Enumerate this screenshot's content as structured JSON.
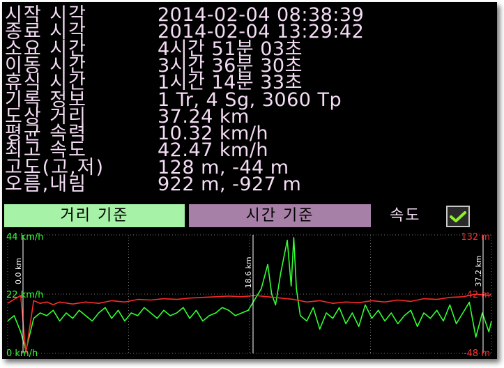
{
  "stats": [
    {
      "label": "시작 시각",
      "value": "2014-02-04 08:38:39"
    },
    {
      "label": "종료 시각",
      "value": "2014-02-04 13:29:42"
    },
    {
      "label": "소요 시간",
      "value": "4시간 51분 03초"
    },
    {
      "label": "이동 시간",
      "value": "3시간 36분 30초"
    },
    {
      "label": "휴식 시간",
      "value": "1시간 14분 33초"
    },
    {
      "label": "기록 정보",
      "value": "1 Tr, 4 Sg, 3060 Tp"
    },
    {
      "label": "도상 거리",
      "value": "37.24 km"
    },
    {
      "label": "평균 속력",
      "value": "10.32 km/h"
    },
    {
      "label": "최고 속도",
      "value": "42.47 km/h"
    },
    {
      "label": "고도(고,저)",
      "value": "128 m, -44 m"
    },
    {
      "label": "오름,내림",
      "value": "922 m, -927 m"
    }
  ],
  "buttons": {
    "distance": "거리 기준",
    "time": "시간 기준",
    "speed_label": "속도",
    "speed_checked": true
  },
  "colors": {
    "speed": "#33ff33",
    "altitude": "#ff2a2a",
    "axis_left_text": "#33ff33",
    "axis_right_text": "#ff3030",
    "grid": "#777777",
    "marker": "#ffffff"
  },
  "chart_data": {
    "type": "line",
    "x_unit": "km",
    "x_range": [
      0,
      37.2
    ],
    "markers": [
      "0.0 km",
      "18.6 km",
      "37.2 km"
    ],
    "left_axis": {
      "labels": [
        "44 km/h",
        "22 km/h",
        "0 km/h"
      ],
      "range": [
        0,
        44
      ]
    },
    "right_axis": {
      "labels": [
        "132 m",
        "42 m",
        "-48 m"
      ],
      "range": [
        -48,
        132
      ]
    },
    "series": [
      {
        "metric": "speed",
        "axis": "left",
        "x": [
          0,
          0.5,
          1.0,
          1.4,
          2.0,
          2.5,
          3.0,
          3.5,
          4.0,
          4.5,
          5.0,
          5.5,
          6.0,
          6.5,
          7.0,
          7.5,
          8.0,
          8.5,
          9.0,
          9.5,
          10.0,
          10.5,
          11.0,
          11.5,
          12.0,
          12.5,
          13.0,
          13.5,
          14.0,
          14.5,
          15.0,
          15.5,
          16.0,
          16.5,
          17.0,
          17.5,
          18.0,
          18.5,
          19.0,
          19.5,
          20.0,
          20.3,
          20.6,
          21.0,
          21.5,
          21.8,
          22.0,
          22.2,
          22.5,
          23.0,
          23.5,
          24.0,
          24.5,
          25.0,
          25.5,
          26.0,
          26.5,
          27.0,
          27.5,
          28.0,
          28.5,
          29.0,
          29.5,
          30.0,
          30.5,
          31.0,
          31.5,
          32.0,
          32.5,
          33.0,
          33.5,
          34.0,
          34.5,
          35.0,
          35.5,
          36.0,
          36.5,
          37.0,
          37.2
        ],
        "y": [
          12,
          14,
          8,
          1,
          13,
          15,
          14,
          16,
          12,
          15,
          13,
          16,
          14,
          12,
          15,
          17,
          13,
          16,
          12,
          15,
          14,
          17,
          15,
          13,
          16,
          14,
          15,
          17,
          13,
          16,
          12,
          14,
          15,
          17,
          16,
          14,
          15,
          16,
          20,
          24,
          33,
          22,
          18,
          30,
          42,
          25,
          43,
          24,
          14,
          12,
          17,
          9,
          15,
          13,
          17,
          11,
          15,
          10,
          18,
          13,
          16,
          12,
          15,
          11,
          14,
          16,
          10,
          15,
          13,
          16,
          12,
          18,
          11,
          15,
          19,
          6,
          15,
          8,
          12
        ]
      },
      {
        "metric": "altitude",
        "axis": "right",
        "x": [
          0,
          0.5,
          1.0,
          1.4,
          2.0,
          2.5,
          3.0,
          3.5,
          4.0,
          5.0,
          6.0,
          7.0,
          8.0,
          9.0,
          10.0,
          11.0,
          12.0,
          13.0,
          14.0,
          15.0,
          16.0,
          17.0,
          18.0,
          19.0,
          20.0,
          21.0,
          22.0,
          23.0,
          24.0,
          25.0,
          26.0,
          27.0,
          28.0,
          29.0,
          30.0,
          31.0,
          32.0,
          33.0,
          34.0,
          35.0,
          36.0,
          37.0,
          37.2
        ],
        "y": [
          28,
          34,
          40,
          -48,
          32,
          28,
          30,
          26,
          30,
          27,
          30,
          28,
          32,
          30,
          34,
          33,
          35,
          34,
          36,
          37,
          38,
          39,
          38,
          40,
          38,
          36,
          34,
          30,
          32,
          28,
          30,
          29,
          32,
          30,
          33,
          31,
          35,
          34,
          37,
          38,
          42,
          40,
          41
        ]
      }
    ]
  }
}
